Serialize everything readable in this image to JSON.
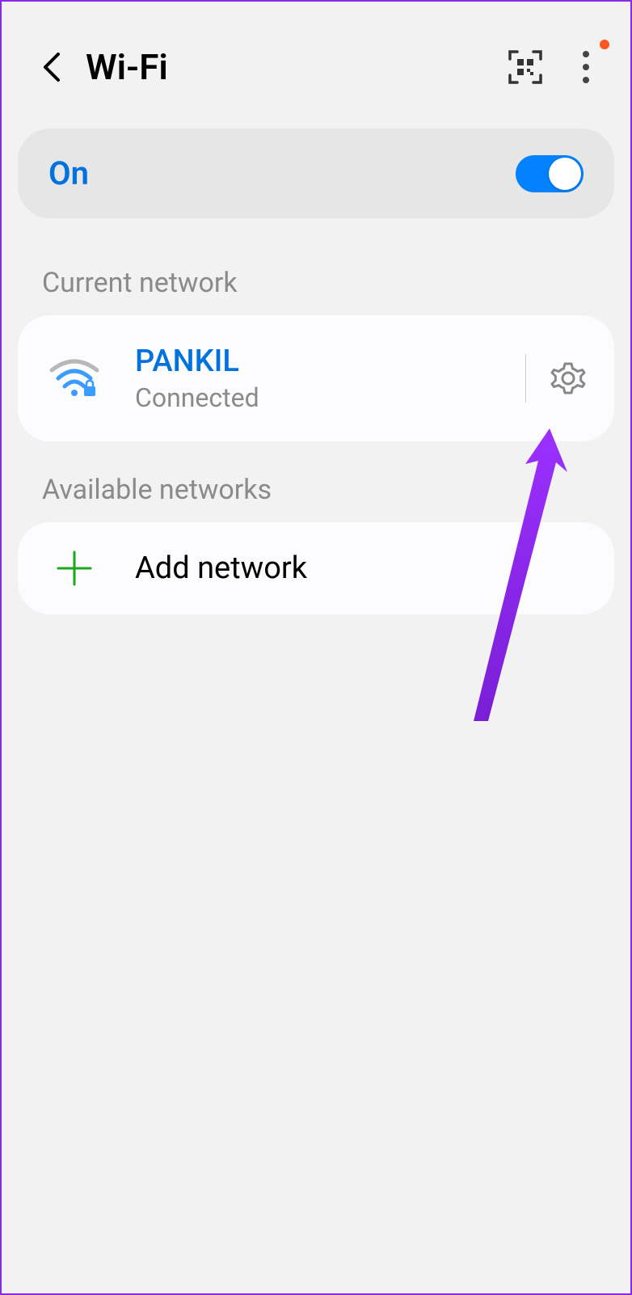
{
  "header": {
    "title": "Wi-Fi"
  },
  "toggle": {
    "label": "On",
    "state": true
  },
  "sections": {
    "current_label": "Current network",
    "available_label": "Available networks"
  },
  "current_network": {
    "name": "PANKIL",
    "status": "Connected"
  },
  "add_network": {
    "label": "Add network"
  },
  "colors": {
    "accent": "#0072de",
    "annotation": "#8a2be2"
  }
}
